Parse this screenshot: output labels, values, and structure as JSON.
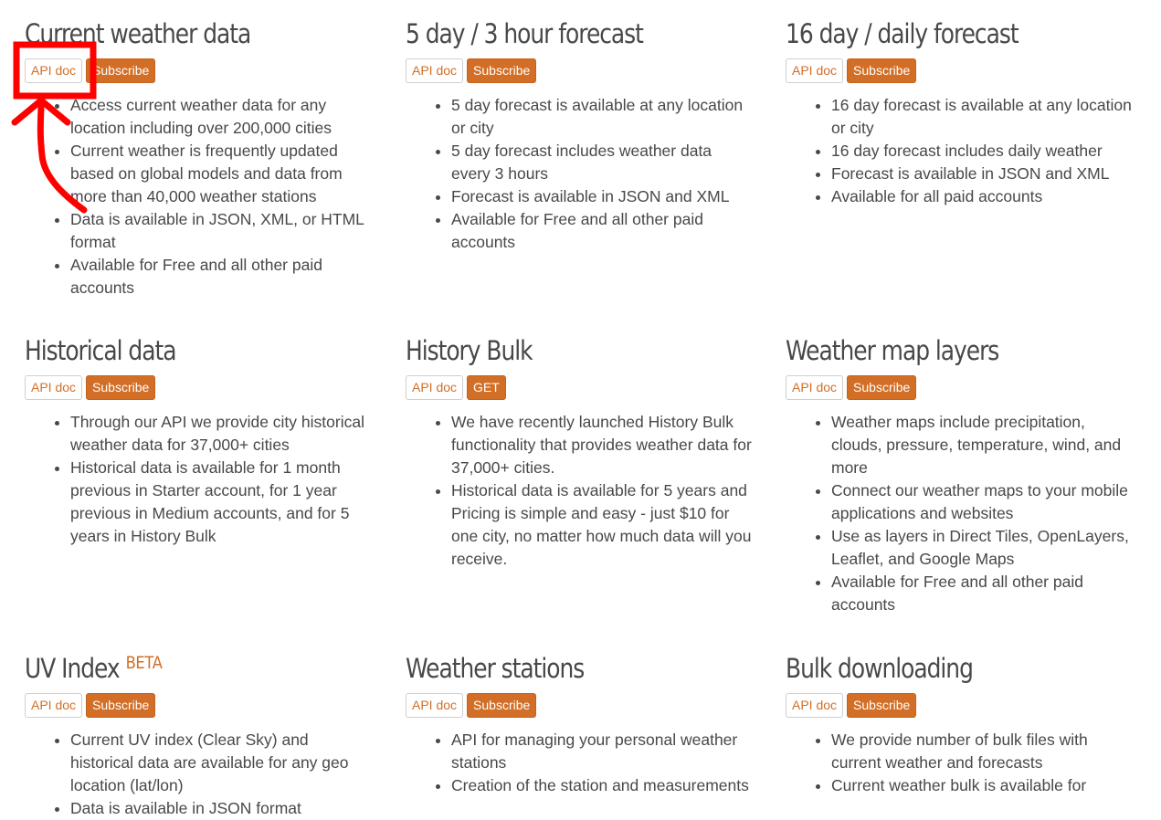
{
  "cards": [
    {
      "title": "Current weather data",
      "beta": "",
      "doc_label": "API doc",
      "action_label": "Subscribe",
      "bullets": [
        "Access current weather data for any location including over 200,000 cities",
        "Current weather is frequently updated based on global models and data from more than 40,000 weather stations",
        "Data is available in JSON, XML, or HTML format",
        "Available for Free and all other paid accounts"
      ]
    },
    {
      "title": "5 day / 3 hour forecast",
      "beta": "",
      "doc_label": "API doc",
      "action_label": "Subscribe",
      "bullets": [
        "5 day forecast is available at any location or city",
        "5 day forecast includes weather data every 3 hours",
        "Forecast is available in JSON and XML",
        "Available for Free and all other paid accounts"
      ]
    },
    {
      "title": "16 day / daily forecast",
      "beta": "",
      "doc_label": "API doc",
      "action_label": "Subscribe",
      "bullets": [
        "16 day forecast is available at any location or city",
        "16 day forecast includes daily weather",
        "Forecast is available in JSON and XML",
        "Available for all paid accounts"
      ]
    },
    {
      "title": "Historical data",
      "beta": "",
      "doc_label": "API doc",
      "action_label": "Subscribe",
      "bullets": [
        "Through our API we provide city historical weather data for 37,000+ cities",
        "Historical data is available for 1 month previous in Starter account, for 1 year previous in Medium accounts, and for 5 years in History Bulk"
      ]
    },
    {
      "title": "History Bulk",
      "beta": "",
      "doc_label": "API doc",
      "action_label": "GET",
      "bullets": [
        "We have recently launched History Bulk functionality that provides weather data for 37,000+ cities.",
        "Historical data is available for 5 years and Pricing is simple and easy - just $10 for one city, no matter how much data will you receive."
      ]
    },
    {
      "title": "Weather map layers",
      "beta": "",
      "doc_label": "API doc",
      "action_label": "Subscribe",
      "bullets": [
        "Weather maps include precipitation, clouds, pressure, temperature, wind, and more",
        "Connect our weather maps to your mobile applications and websites",
        "Use as layers in Direct Tiles, OpenLayers, Leaflet, and Google Maps",
        "Available for Free and all other paid accounts"
      ]
    },
    {
      "title": "UV Index",
      "beta": "BETA",
      "doc_label": "API doc",
      "action_label": "Subscribe",
      "bullets": [
        "Current UV index (Clear Sky) and historical data are available for any geo location (lat/lon)",
        "Data is available in JSON format"
      ]
    },
    {
      "title": "Weather stations",
      "beta": "",
      "doc_label": "API doc",
      "action_label": "Subscribe",
      "bullets": [
        "API for managing your personal weather stations",
        "Creation of the station and measurements"
      ]
    },
    {
      "title": "Bulk downloading",
      "beta": "",
      "doc_label": "API doc",
      "action_label": "Subscribe",
      "bullets": [
        "We provide number of bulk files with current weather and forecasts",
        "Current weather bulk is available for"
      ]
    }
  ],
  "colors": {
    "accent": "#d26e26",
    "text": "#48484a",
    "annotation": "#ff0000"
  },
  "icons": [
    "annotation-highlight-box",
    "annotation-curved-arrow"
  ]
}
